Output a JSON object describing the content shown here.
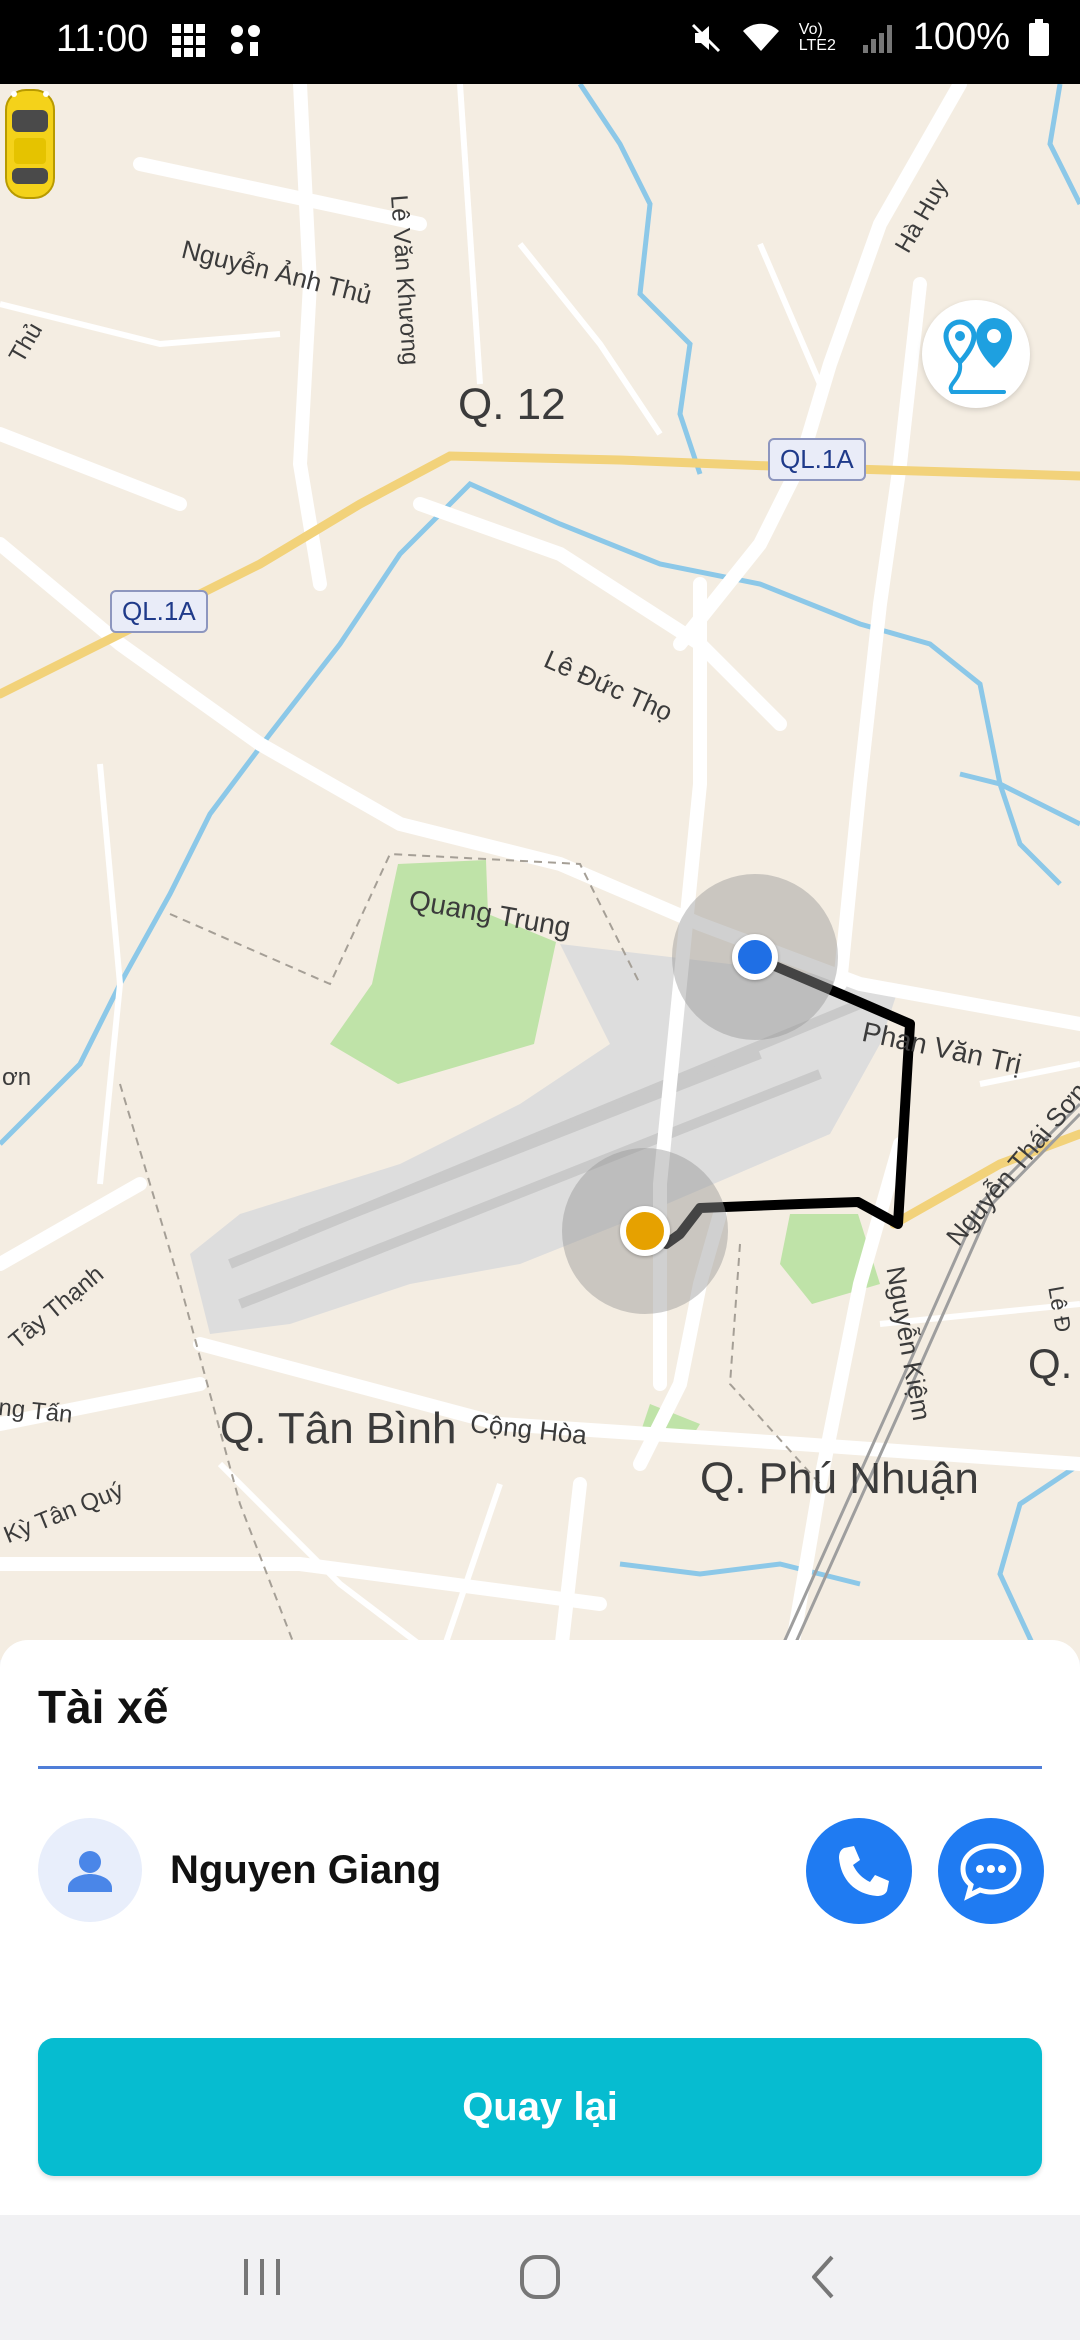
{
  "status_bar": {
    "time": "11:00",
    "battery": "100%",
    "network": "Vo) LTE2",
    "icons": [
      "grid-icon",
      "notification-icon",
      "mute-icon",
      "wifi-icon",
      "signal-icon",
      "battery-icon"
    ]
  },
  "map": {
    "labels": {
      "district_q12": "Q. 12",
      "district_tanbinh": "Q. Tân Bình",
      "district_phunhuan": "Q. Phú Nhuận",
      "district_edge": "Q.",
      "road_nguyenanhthu": "Nguyễn Ảnh Thủ",
      "road_levankhuong": "Lê Văn Khương",
      "road_leductho": "Lê Đức Thọ",
      "road_quangtrung": "Quang Trung",
      "road_phanvantri": "Phan Văn Trị",
      "road_nguyenthaison": "Nguyễn Thái Sơn",
      "road_nguyenkiem": "Nguyễn Kiệm",
      "road_conghoa": "Cộng Hòa",
      "road_taythanh": "Tây Thạnh",
      "road_tayTanQuy": "Kỳ Tân Quý",
      "road_ngTan": "ng Tấn",
      "road_hahuy": "Hà Huy",
      "road_thu": "Thủ",
      "road_on": "ơn",
      "road_lec": "Lê Đ",
      "badge_ql1a_1": "QL.1A",
      "badge_ql1a_2": "QL.1A"
    },
    "colors": {
      "pickup": "#1f6fe5",
      "dropoff": "#e6a100",
      "route": "#000000",
      "highway": "#f2d27a",
      "water": "#8cc8e8",
      "park": "#bfe3a8",
      "airport": "#dcdcdc"
    }
  },
  "sheet": {
    "title": "Tài xế",
    "driver_name": "Nguyen Giang",
    "back_button": "Quay lại",
    "accent": "#06bcd0"
  },
  "nav": {
    "buttons": [
      "recent-apps-icon",
      "home-icon",
      "back-icon"
    ]
  }
}
